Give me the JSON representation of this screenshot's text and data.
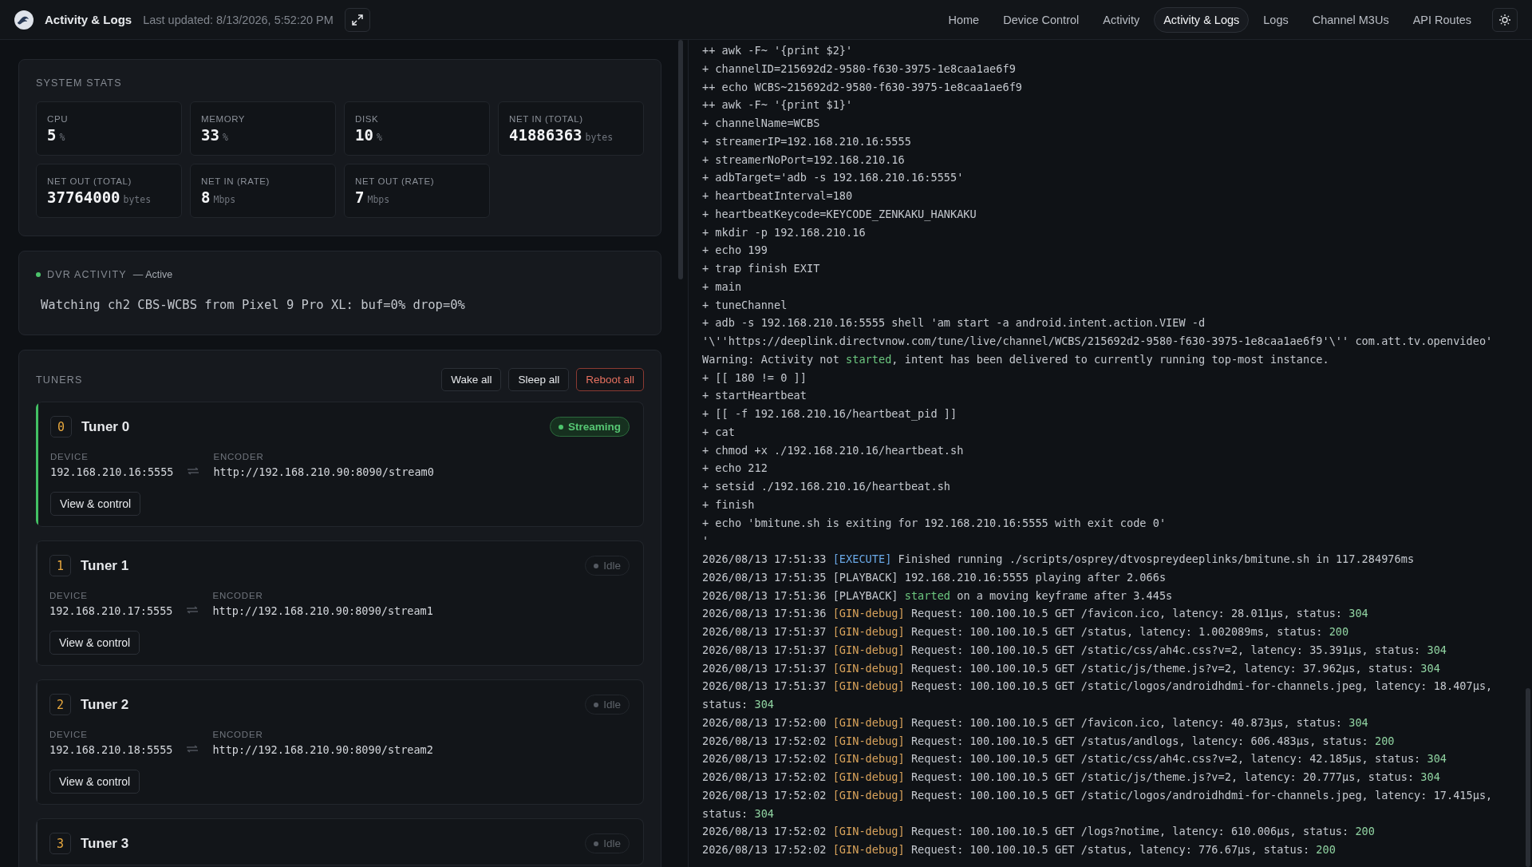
{
  "header": {
    "title": "Activity & Logs",
    "last_updated": "Last updated: 8/13/2026, 5:52:20 PM",
    "nav": [
      {
        "label": "Home",
        "selected": false
      },
      {
        "label": "Device Control",
        "selected": false
      },
      {
        "label": "Activity",
        "selected": false
      },
      {
        "label": "Activity & Logs",
        "selected": true
      },
      {
        "label": "Logs",
        "selected": false
      },
      {
        "label": "Channel M3Us",
        "selected": false
      },
      {
        "label": "API Routes",
        "selected": false
      }
    ]
  },
  "system_stats": {
    "title": "SYSTEM STATS",
    "stats": [
      {
        "label": "CPU",
        "value": "5",
        "unit": "%"
      },
      {
        "label": "MEMORY",
        "value": "33",
        "unit": "%"
      },
      {
        "label": "DISK",
        "value": "10",
        "unit": "%"
      },
      {
        "label": "NET IN (TOTAL)",
        "value": "41886363",
        "unit": "bytes"
      },
      {
        "label": "NET OUT (TOTAL)",
        "value": "37764000",
        "unit": "bytes"
      },
      {
        "label": "NET IN (RATE)",
        "value": "8",
        "unit": "Mbps"
      },
      {
        "label": "NET OUT (RATE)",
        "value": "7",
        "unit": "Mbps"
      }
    ]
  },
  "dvr_activity": {
    "title": "DVR ACTIVITY",
    "state": "— Active",
    "active": true,
    "message": "Watching ch2 CBS-WCBS from Pixel 9 Pro XL: buf=0% drop=0%"
  },
  "tuners": {
    "title": "TUNERS",
    "buttons": [
      {
        "label": "Wake all",
        "kind": "default"
      },
      {
        "label": "Sleep all",
        "kind": "default"
      },
      {
        "label": "Reboot all",
        "kind": "danger"
      }
    ],
    "items": [
      {
        "number": "0",
        "name": "Tuner 0",
        "status": "Streaming",
        "active": true,
        "device_label": "DEVICE",
        "device": "192.168.210.16:5555",
        "encoder_label": "ENCODER",
        "encoder": "http://192.168.210.90:8090/stream0",
        "button": "View & control"
      },
      {
        "number": "1",
        "name": "Tuner 1",
        "status": "Idle",
        "active": false,
        "device_label": "DEVICE",
        "device": "192.168.210.17:5555",
        "encoder_label": "ENCODER",
        "encoder": "http://192.168.210.90:8090/stream1",
        "button": "View & control"
      },
      {
        "number": "2",
        "name": "Tuner 2",
        "status": "Idle",
        "active": false,
        "device_label": "DEVICE",
        "device": "192.168.210.18:5555",
        "encoder_label": "ENCODER",
        "encoder": "http://192.168.210.90:8090/stream2",
        "button": "View & control"
      },
      {
        "number": "3",
        "name": "Tuner 3",
        "status": "Idle",
        "active": false
      }
    ]
  },
  "log": {
    "lines": [
      [
        {
          "kind": "plain",
          "text": "++ awk -F~ '{print $2}'"
        }
      ],
      [
        {
          "kind": "plain",
          "text": "+ channelID=215692d2-9580-f630-3975-1e8caa1ae6f9"
        }
      ],
      [
        {
          "kind": "plain",
          "text": "++ echo WCBS~215692d2-9580-f630-3975-1e8caa1ae6f9"
        }
      ],
      [
        {
          "kind": "plain",
          "text": "++ awk -F~ '{print $1}'"
        }
      ],
      [
        {
          "kind": "plain",
          "text": "+ channelName=WCBS"
        }
      ],
      [
        {
          "kind": "plain",
          "text": "+ streamerIP=192.168.210.16:5555"
        }
      ],
      [
        {
          "kind": "plain",
          "text": "+ streamerNoPort=192.168.210.16"
        }
      ],
      [
        {
          "kind": "plain",
          "text": "+ adbTarget='adb -s 192.168.210.16:5555'"
        }
      ],
      [
        {
          "kind": "plain",
          "text": "+ heartbeatInterval=180"
        }
      ],
      [
        {
          "kind": "plain",
          "text": "+ heartbeatKeycode=KEYCODE_ZENKAKU_HANKAKU"
        }
      ],
      [
        {
          "kind": "plain",
          "text": "+ mkdir -p 192.168.210.16"
        }
      ],
      [
        {
          "kind": "plain",
          "text": "+ echo 199"
        }
      ],
      [
        {
          "kind": "plain",
          "text": "+ trap finish EXIT"
        }
      ],
      [
        {
          "kind": "plain",
          "text": "+ main"
        }
      ],
      [
        {
          "kind": "plain",
          "text": "+ tuneChannel"
        }
      ],
      [
        {
          "kind": "plain",
          "text": "+ adb -s 192.168.210.16:5555 shell 'am start -a android.intent.action.VIEW -d '\\''https://deeplink.directvnow.com/tune/live/channel/WCBS/215692d2-9580-f630-3975-1e8caa1ae6f9'\\'' com.att.tv.openvideo'"
        }
      ],
      [
        {
          "kind": "plain",
          "text": "Warning: Activity not "
        },
        {
          "kind": "ok",
          "text": "started"
        },
        {
          "kind": "plain",
          "text": ", intent has been delivered to currently running top-most instance."
        }
      ],
      [
        {
          "kind": "plain",
          "text": "+ [[ 180 != 0 ]]"
        }
      ],
      [
        {
          "kind": "plain",
          "text": "+ startHeartbeat"
        }
      ],
      [
        {
          "kind": "plain",
          "text": "+ [[ -f 192.168.210.16/heartbeat_pid ]]"
        }
      ],
      [
        {
          "kind": "plain",
          "text": "+ cat"
        }
      ],
      [
        {
          "kind": "plain",
          "text": "+ chmod +x ./192.168.210.16/heartbeat.sh"
        }
      ],
      [
        {
          "kind": "plain",
          "text": "+ echo 212"
        }
      ],
      [
        {
          "kind": "plain",
          "text": "+ setsid ./192.168.210.16/heartbeat.sh"
        }
      ],
      [
        {
          "kind": "plain",
          "text": "+ finish"
        }
      ],
      [
        {
          "kind": "plain",
          "text": "+ echo 'bmitune.sh is exiting for 192.168.210.16:5555 with exit code 0'"
        }
      ],
      [
        {
          "kind": "plain",
          "text": "'"
        }
      ],
      [
        {
          "kind": "plain",
          "text": "2026/08/13 17:51:33 "
        },
        {
          "kind": "execute",
          "text": "[EXECUTE]"
        },
        {
          "kind": "plain",
          "text": " Finished running ./scripts/osprey/dtvospreydeeplinks/bmitune.sh in 117.284976ms"
        }
      ],
      [
        {
          "kind": "plain",
          "text": "2026/08/13 17:51:35 [PLAYBACK] 192.168.210.16:5555 playing after 2.066s"
        }
      ],
      [
        {
          "kind": "plain",
          "text": "2026/08/13 17:51:36 [PLAYBACK] "
        },
        {
          "kind": "ok",
          "text": "started"
        },
        {
          "kind": "plain",
          "text": " on a moving keyframe after 3.445s"
        }
      ],
      [
        {
          "kind": "plain",
          "text": "2026/08/13 17:51:36 "
        },
        {
          "kind": "gin",
          "text": "[GIN-debug]"
        },
        {
          "kind": "plain",
          "text": " Request: 100.100.10.5 GET /favicon.ico, latency: 28.011µs, status: "
        },
        {
          "kind": "status",
          "text": "304"
        }
      ],
      [
        {
          "kind": "plain",
          "text": "2026/08/13 17:51:37 "
        },
        {
          "kind": "gin",
          "text": "[GIN-debug]"
        },
        {
          "kind": "plain",
          "text": " Request: 100.100.10.5 GET /status, latency: 1.002089ms, status: "
        },
        {
          "kind": "status",
          "text": "200"
        }
      ],
      [
        {
          "kind": "plain",
          "text": "2026/08/13 17:51:37 "
        },
        {
          "kind": "gin",
          "text": "[GIN-debug]"
        },
        {
          "kind": "plain",
          "text": " Request: 100.100.10.5 GET /static/css/ah4c.css?v=2, latency: 35.391µs, status: "
        },
        {
          "kind": "status",
          "text": "304"
        }
      ],
      [
        {
          "kind": "plain",
          "text": "2026/08/13 17:51:37 "
        },
        {
          "kind": "gin",
          "text": "[GIN-debug]"
        },
        {
          "kind": "plain",
          "text": " Request: 100.100.10.5 GET /static/js/theme.js?v=2, latency: 37.962µs, status: "
        },
        {
          "kind": "status",
          "text": "304"
        }
      ],
      [
        {
          "kind": "plain",
          "text": "2026/08/13 17:51:37 "
        },
        {
          "kind": "gin",
          "text": "[GIN-debug]"
        },
        {
          "kind": "plain",
          "text": " Request: 100.100.10.5 GET /static/logos/androidhdmi-for-channels.jpeg, latency: 18.407µs, status: "
        },
        {
          "kind": "status",
          "text": "304"
        }
      ],
      [
        {
          "kind": "plain",
          "text": "2026/08/13 17:52:00 "
        },
        {
          "kind": "gin",
          "text": "[GIN-debug]"
        },
        {
          "kind": "plain",
          "text": " Request: 100.100.10.5 GET /favicon.ico, latency: 40.873µs, status: "
        },
        {
          "kind": "status",
          "text": "304"
        }
      ],
      [
        {
          "kind": "plain",
          "text": "2026/08/13 17:52:02 "
        },
        {
          "kind": "gin",
          "text": "[GIN-debug]"
        },
        {
          "kind": "plain",
          "text": " Request: 100.100.10.5 GET /status/andlogs, latency: 606.483µs, status: "
        },
        {
          "kind": "status",
          "text": "200"
        }
      ],
      [
        {
          "kind": "plain",
          "text": "2026/08/13 17:52:02 "
        },
        {
          "kind": "gin",
          "text": "[GIN-debug]"
        },
        {
          "kind": "plain",
          "text": " Request: 100.100.10.5 GET /static/css/ah4c.css?v=2, latency: 42.185µs, status: "
        },
        {
          "kind": "status",
          "text": "304"
        }
      ],
      [
        {
          "kind": "plain",
          "text": "2026/08/13 17:52:02 "
        },
        {
          "kind": "gin",
          "text": "[GIN-debug]"
        },
        {
          "kind": "plain",
          "text": " Request: 100.100.10.5 GET /static/js/theme.js?v=2, latency: 20.777µs, status: "
        },
        {
          "kind": "status",
          "text": "304"
        }
      ],
      [
        {
          "kind": "plain",
          "text": "2026/08/13 17:52:02 "
        },
        {
          "kind": "gin",
          "text": "[GIN-debug]"
        },
        {
          "kind": "plain",
          "text": " Request: 100.100.10.5 GET /static/logos/androidhdmi-for-channels.jpeg, latency: 17.415µs, status: "
        },
        {
          "kind": "status",
          "text": "304"
        }
      ],
      [
        {
          "kind": "plain",
          "text": "2026/08/13 17:52:02 "
        },
        {
          "kind": "gin",
          "text": "[GIN-debug]"
        },
        {
          "kind": "plain",
          "text": " Request: 100.100.10.5 GET /logs?notime, latency: 610.006µs, status: "
        },
        {
          "kind": "status",
          "text": "200"
        }
      ],
      [
        {
          "kind": "plain",
          "text": "2026/08/13 17:52:02 "
        },
        {
          "kind": "gin",
          "text": "[GIN-debug]"
        },
        {
          "kind": "plain",
          "text": " Request: 100.100.10.5 GET /status, latency: 776.67µs, status: "
        },
        {
          "kind": "status",
          "text": "200"
        }
      ]
    ]
  }
}
